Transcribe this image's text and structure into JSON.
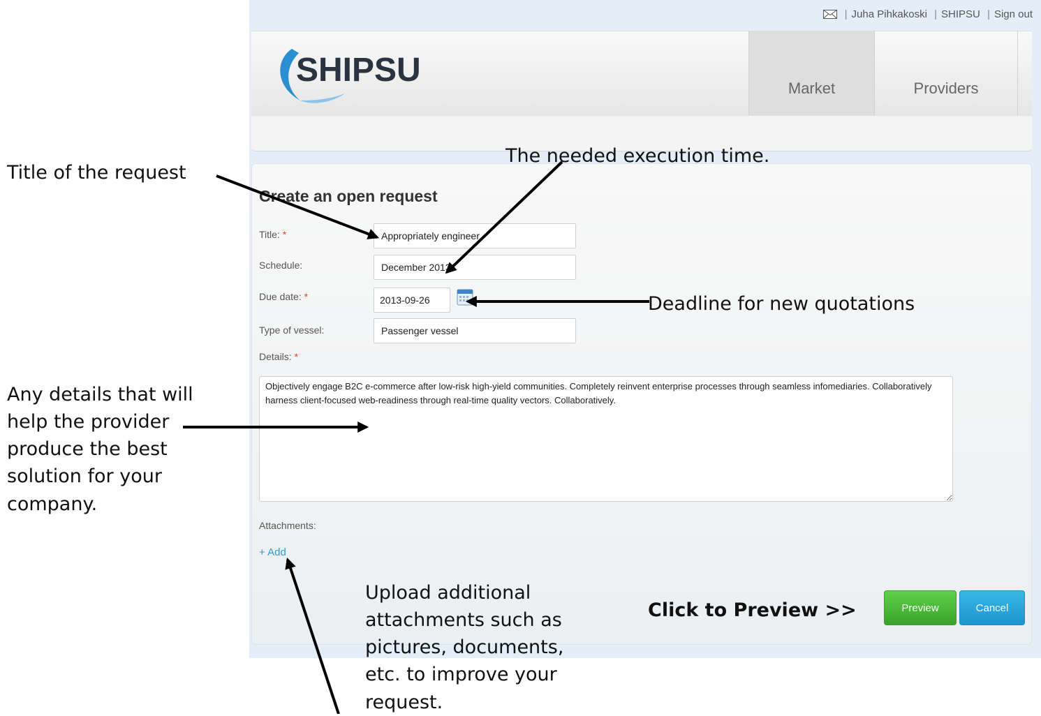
{
  "topbar": {
    "user": "Juha Pihkakoski",
    "company": "SHIPSU",
    "signout": "Sign out",
    "sep": "|"
  },
  "logo": {
    "text": "SHIPSU"
  },
  "nav": {
    "market": "Market",
    "providers": "Providers"
  },
  "form": {
    "heading": "Create an open request",
    "required_mark": "*",
    "title_label": "Title:",
    "title_value": "Appropriately engineer.",
    "schedule_label": "Schedule:",
    "schedule_value": "December 2013",
    "due_label": "Due date:",
    "due_value": "2013-09-26",
    "vessel_label": "Type of vessel:",
    "vessel_value": "Passenger vessel",
    "details_label": "Details:",
    "details_value": "Objectively engage B2C e-commerce after low-risk high-yield communities. Completely reinvent enterprise processes through seamless infomediaries. Collaboratively harness client-focused web-readiness through real-time quality vectors. Collaboratively.",
    "attachments_label": "Attachments:",
    "add_label": "+ Add"
  },
  "buttons": {
    "preview": "Preview",
    "cancel": "Cancel"
  },
  "annotations": {
    "title_note": "Title of the request",
    "schedule_note": "The needed execution time.",
    "deadline_note": "Deadline for new quotations",
    "details_note": [
      "Any details that will",
      "help the provider",
      "produce the best",
      "solution for your",
      "company."
    ],
    "attach_note": [
      "Upload additional",
      "attachments such as",
      "pictures, documents,",
      "etc. to improve your",
      "request."
    ],
    "preview_note": "Click to Preview >>"
  },
  "colors": {
    "accent_blue": "#2b9ad6",
    "preview_green": "#3aa22a",
    "cancel_blue": "#1c94cd",
    "required_red": "#e04a1e"
  }
}
